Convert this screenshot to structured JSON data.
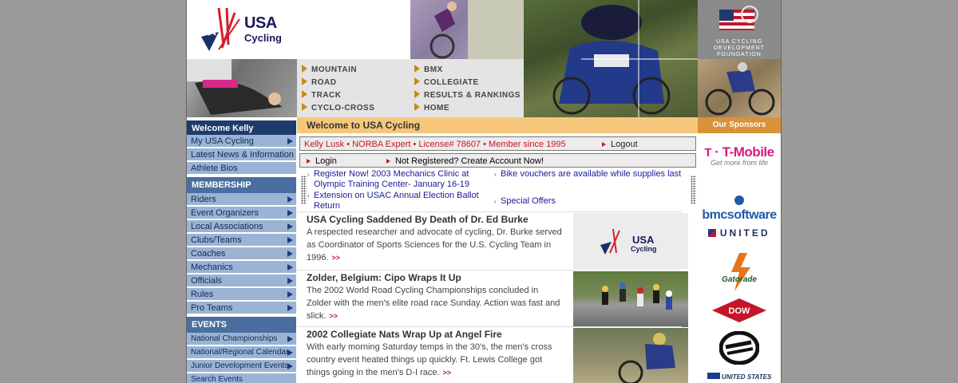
{
  "brand": {
    "line1": "USA",
    "line2": "Cycling"
  },
  "foundation": {
    "lines": [
      "USA CYCLING",
      "DEVELOPMENT",
      "FOUNDATION"
    ]
  },
  "nav": {
    "left": [
      "MOUNTAIN",
      "ROAD",
      "TRACK",
      "CYCLO-CROSS"
    ],
    "right": [
      "BMX",
      "COLLEGIATE",
      "RESULTS & RANKINGS",
      "HOME"
    ]
  },
  "sidebar": {
    "welcome": "Welcome Kelly",
    "top_items": [
      "My USA Cycling",
      "Latest News & Information",
      "Athlete Bios"
    ],
    "membership_header": "MEMBERSHIP",
    "membership_items": [
      "Riders",
      "Event Organizers",
      "Local Associations",
      "Clubs/Teams",
      "Coaches",
      "Mechanics",
      "Officials",
      "Rules",
      "Pro Teams"
    ],
    "events_header": "EVENTS",
    "events_items": [
      "National Championships",
      "National/Regional Calendar",
      "Junior Development Events",
      "Search Events"
    ]
  },
  "main": {
    "welcome_title": "Welcome to USA Cycling",
    "user_info": "Kelly Lusk • NORBA Expert • License# 78607 • Member since 1995",
    "logout": "Logout",
    "login": "Login",
    "register": "Not Registered?  Create Account Now!",
    "ticker": {
      "left": [
        "Register Now! 2003 Mechanics Clinic at Olympic Training Center- January 16-19",
        "Extension on USAC Annual Election Ballot Return"
      ],
      "right": [
        "Bike vouchers are available while supplies last",
        "Special Offers"
      ]
    },
    "stories": [
      {
        "title": "USA Cycling Saddened By Death of Dr. Ed Burke",
        "body": "A respected researcher and advocate of cycling, Dr. Burke served as Coordinator of Sports Sciences for the U.S. Cycling Team in 1996.",
        "more": ">>"
      },
      {
        "title": "Zolder, Belgium: Cipo Wraps It Up",
        "body": "The 2002 World Road Cycling Championships concluded in Zolder with the men's elite road race Sunday. Action was fast and slick.",
        "more": ">>"
      },
      {
        "title": "2002 Collegiate Nats Wrap Up at Angel Fire",
        "body": "With early morning Saturday temps in the 30's, the men's cross country event heated things up quickly. Ft. Lewis College got things going in the men's D-I race.",
        "more": ">>"
      }
    ],
    "story1_thumb_logo": {
      "line1": "USA",
      "line2": "Cycling"
    }
  },
  "sponsors": {
    "header": "Our Sponsors",
    "items": [
      {
        "name": "T-Mobile",
        "tagline": "Get more from life"
      },
      {
        "name": "bmcsoftware"
      },
      {
        "name": "UNITED"
      },
      {
        "name": "Gatorade"
      },
      {
        "name": "DOW"
      },
      {
        "name": "UNITED STATES"
      }
    ]
  },
  "colors": {
    "navy": "#1f3b6b",
    "side_item": "#9bb3d4",
    "welcome_bar": "#f6c77a",
    "sponsor_hdr": "#d8923a",
    "accent_red": "#c4162a"
  }
}
